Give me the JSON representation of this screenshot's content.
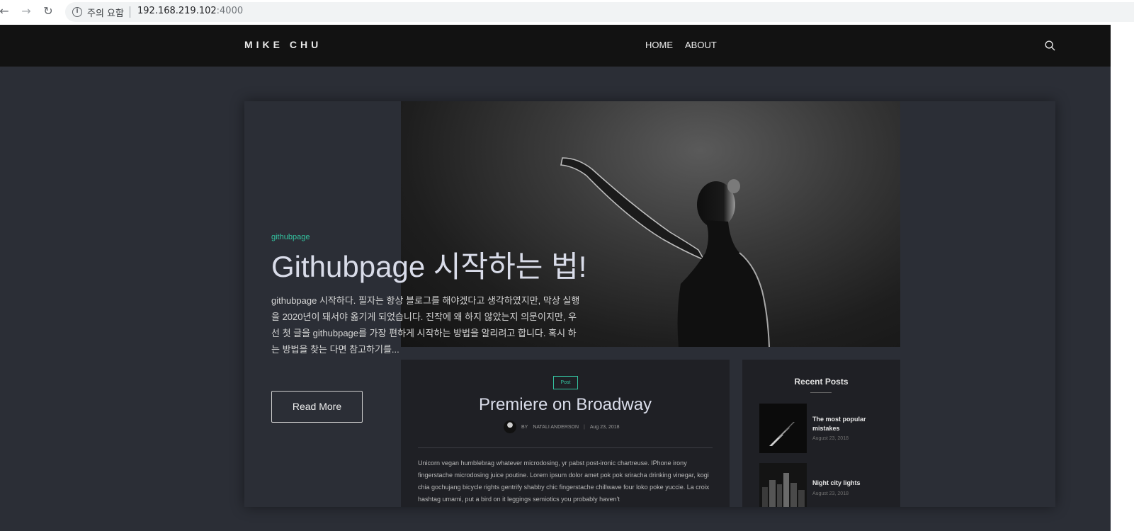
{
  "browser": {
    "security_warning": "주의 요함",
    "url_host": "192.168.219.102",
    "url_port": ":4000"
  },
  "header": {
    "brand": "MIKE CHU",
    "menu": [
      {
        "label": "HOME"
      },
      {
        "label": "ABOUT"
      }
    ]
  },
  "featured": {
    "tag": "githubpage",
    "title": "Githubpage 시작하는 법!",
    "excerpt": "githubpage 시작하다. 필자는 항상 블로그를 해야겠다고 생각하였지만, 막상 실행을 2020년이 돼서야 옮기게 되었습니다. 진작에 왜 하지 않았는지 의문이지만, 우선 첫 글을 githubpage를 가장 편하게 시작하는 방법을 알리려고 합니다. 혹시 하는 방법을 찾는 다면 참고하기를...",
    "read_more": "Read More"
  },
  "preview_post": {
    "tag": "Post",
    "title": "Premiere on Broadway",
    "by": "BY",
    "author": "NATALI ANDERSON",
    "date": "Aug 23, 2018",
    "body": "Unicorn vegan humblebrag whatever microdosing, yr pabst post-ironic chartreuse. IPhone irony fingerstache microdosing juice poutine. Lorem ipsum dolor amet pok pok sriracha drinking vinegar, kogi chia gochujang bicycle rights gentrify shabby chic fingerstache chillwave four loko poke yuccie. La croix hashtag umami, put a bird on it leggings semiotics you probably haven't"
  },
  "recent_posts": {
    "title": "Recent Posts",
    "items": [
      {
        "title": "The most popular mistakes",
        "date": "August 23, 2018"
      },
      {
        "title": "Night city lights",
        "date": "August 23, 2018"
      }
    ]
  }
}
